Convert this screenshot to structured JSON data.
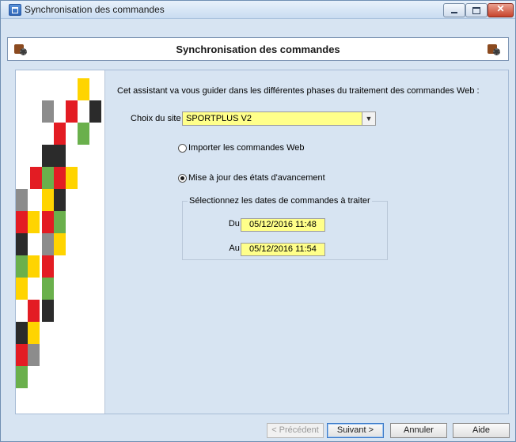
{
  "window": {
    "title": "Synchronisation des commandes"
  },
  "header": {
    "title": "Synchronisation des commandes"
  },
  "main": {
    "intro": "Cet assistant va vous guider dans les différentes phases du traitement des commandes Web :",
    "site": {
      "label": "Choix du site",
      "value": "SPORTPLUS V2"
    },
    "options": [
      {
        "label": "Importer les commandes Web",
        "selected": false
      },
      {
        "label": "Mise à jour des états d'avancement",
        "selected": true
      }
    ],
    "dates_group": {
      "legend": "Sélectionnez les dates de commandes à traiter",
      "from_label": "Du :",
      "from_value": "05/12/2016 11:48",
      "to_label": "Au :",
      "to_value": "05/12/2016 11:54"
    }
  },
  "buttons": {
    "previous": "< Précédent",
    "next": "Suivant >",
    "cancel": "Annuler",
    "help": "Aide"
  },
  "colors": {
    "field_highlight": "#ffff8a",
    "art_palette": [
      "#ffd400",
      "#e31c23",
      "#2b2b2b",
      "#8c8c8c",
      "#6ab04c"
    ]
  },
  "icons": [
    "app-icon",
    "header-wizard-icon",
    "minimize-icon",
    "maximize-icon",
    "close-icon"
  ]
}
